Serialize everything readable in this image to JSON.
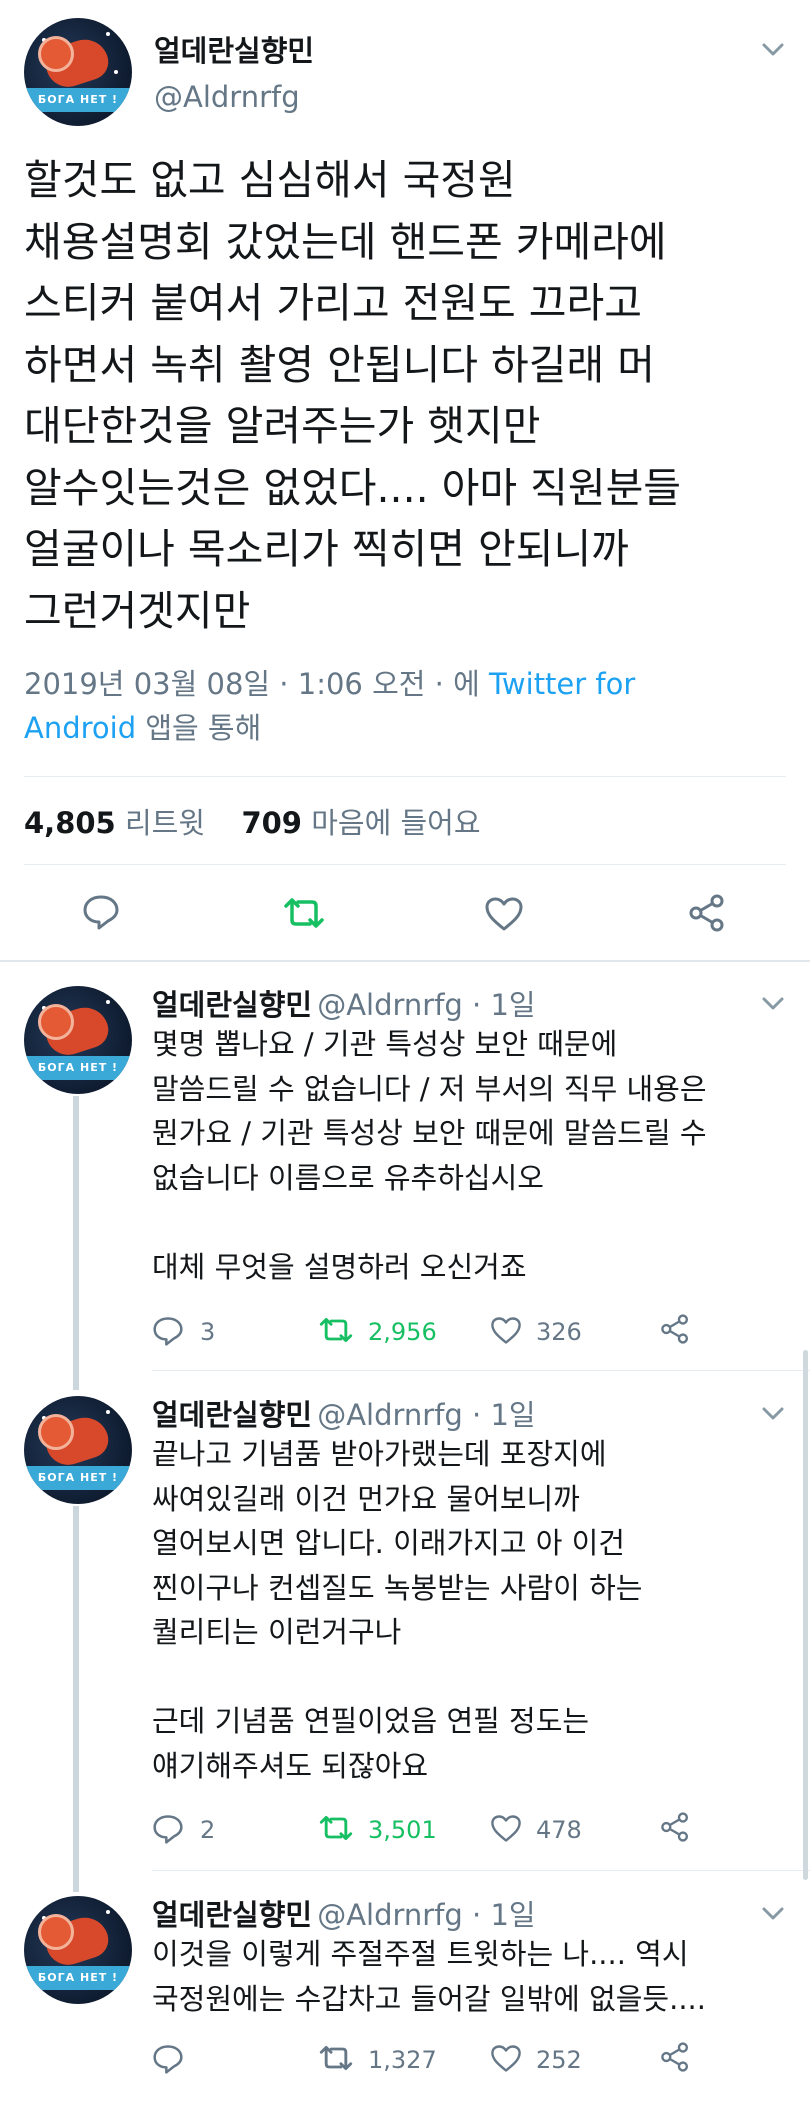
{
  "main_tweet": {
    "display_name": "얼데란실향민",
    "handle": "@Aldrnrfg",
    "avatar_banner": "БОГА НЕТ !",
    "lines": [
      "할것도 없고 심심해서 국정원",
      "채용설명회 갔었는데 핸드폰 카메라에",
      "스티커 붙여서 가리고 전원도 끄라고",
      "하면서 녹취 촬영 안됩니다 하길래 머",
      "대단한것을 알려주는가 햇지만",
      "알수잇는것은 없었다.... 아마 직원분들",
      "얼굴이나 목소리가 찍히면 안되니까",
      "그런거겟지만"
    ],
    "timestamp": "2019년 03월 08일 · 1:06 오전 · 에 ",
    "via_part1": "Twitter for",
    "via_part2": "Android",
    "via_suffix": " 앱을 통해",
    "retweet_count": "4,805",
    "retweet_label": "리트윗",
    "like_count": "709",
    "like_label": "마음에 들어요",
    "actions": [
      "reply-icon",
      "retweet-icon",
      "like-icon",
      "share-icon"
    ]
  },
  "replies": [
    {
      "display_name": "얼데란실향민",
      "handle": "@Aldrnrfg · 1일",
      "text": "몇명 뽑나요 / 기관 특성상 보안 때문에\n말씀드릴 수 없습니다 / 저 부서의 직무 내용은\n뭔가요 / 기관 특성상 보안 때문에 말씀드릴 수\n없습니다 이름으로 유추하십시오\n\n대체 무엇을 설명하러 오신거죠",
      "reply_count": "3",
      "retweet_count": "2,956",
      "like_count": "326"
    },
    {
      "display_name": "얼데란실향민",
      "handle": "@Aldrnrfg · 1일",
      "text": "끝나고 기념품 받아가랬는데 포장지에\n싸여있길래 이건 먼가요 물어보니까\n열어보시면 압니다. 이래가지고 아 이건\n찐이구나 컨셉질도 녹봉받는 사람이 하는\n퀄리티는 이런거구나\n\n근데 기념품 연필이었음 연필 정도는\n얘기해주셔도 되잖아요",
      "reply_count": "2",
      "retweet_count": "3,501",
      "like_count": "478"
    },
    {
      "display_name": "얼데란실향민",
      "handle": "@Aldrnrfg · 1일",
      "text": "이것을 이렇게 주절주절 트윗하는 나.... 역시\n국정원에는 수갑차고 들어갈 일밖에 없을듯....",
      "reply_count": "",
      "retweet_count": "1,327",
      "like_count": "252"
    }
  ],
  "colors": {
    "text": "#14171a",
    "secondary": "#657786",
    "link": "#1da1f2",
    "retweet_green": "#17bf63",
    "divider": "#e6ecf0",
    "thread_line": "#ccd6dd"
  }
}
